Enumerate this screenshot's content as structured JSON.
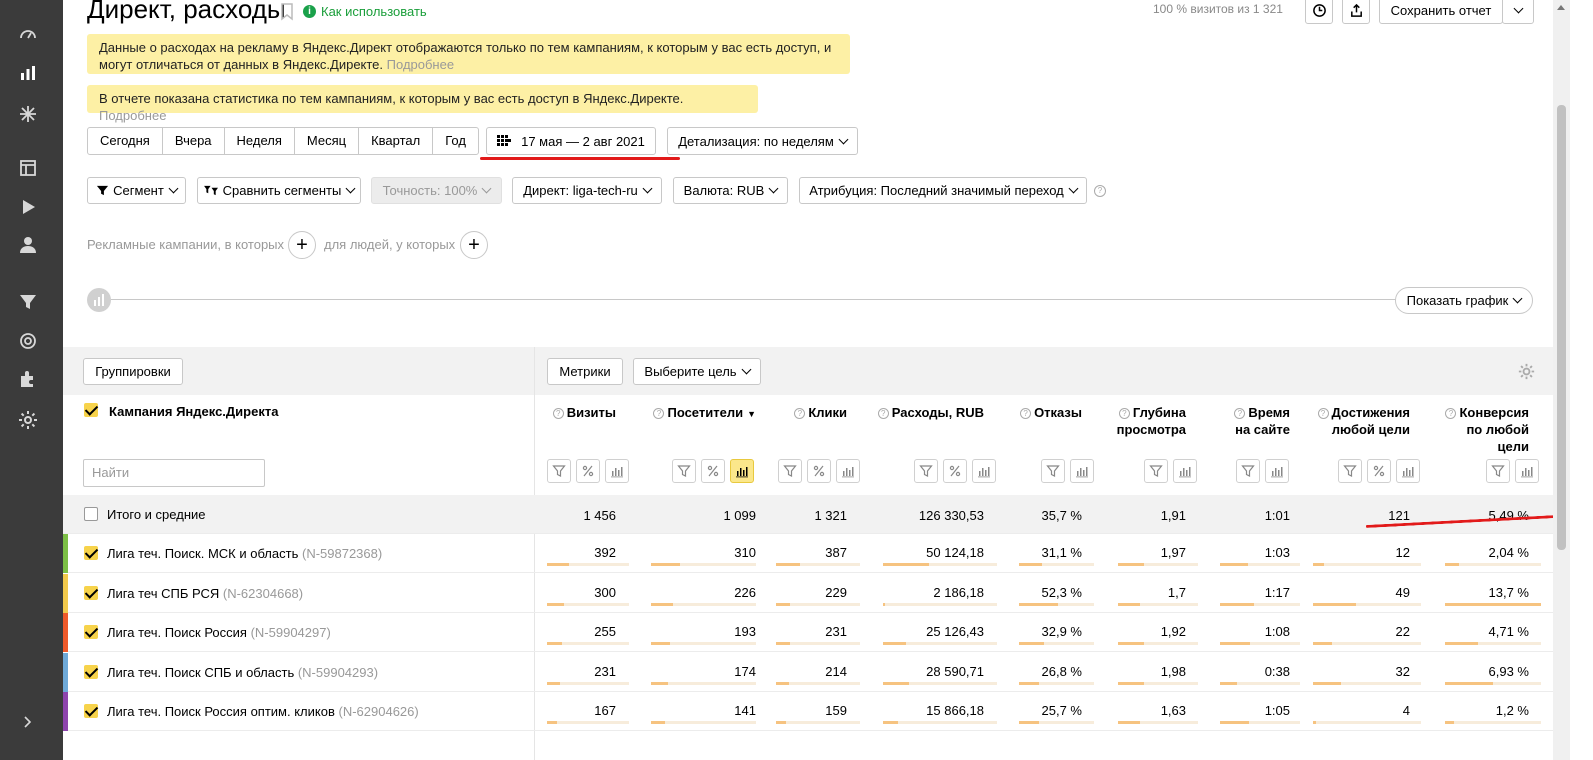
{
  "page": {
    "title": "Директ, расходы",
    "howto": "Как использовать",
    "visits_pct": "100 % визитов из 1 321",
    "save_report": "Сохранить отчет"
  },
  "notices": {
    "n1_text": "Данные о расходах на рекламу в Яндекс.Директ отображаются только по тем кампаниям, к которым у вас есть доступ, и могут отличаться от данных в Яндекс.Директе.",
    "n1_more": "Подробнее",
    "n2_text": "В отчете показана статистика по тем кампаниям, к которым у вас есть доступ в Яндекс.Директе.",
    "n2_more": "Подробнее"
  },
  "periods": [
    "Сегодня",
    "Вчера",
    "Неделя",
    "Месяц",
    "Квартал",
    "Год"
  ],
  "date_range": "17 мая — 2 авг 2021",
  "detail": "Детализация: по неделям",
  "filters": {
    "segment": "Сегмент",
    "compare": "Сравнить сегменты",
    "accuracy": "Точность: 100%",
    "direct": "Директ: liga-tech-ru",
    "currency": "Валюта: RUB",
    "attribution": "Атрибуция: Последний значимый переход"
  },
  "ad_filter": {
    "part1": "Рекламные кампании, в которых",
    "part2": "для людей, у которых"
  },
  "show_chart": "Показать график",
  "table": {
    "groupings": "Группировки",
    "metrics": "Метрики",
    "goal": "Выберите цель",
    "dim_header": "Кампания Яндекс.Директа",
    "search_placeholder": "Найти",
    "columns": {
      "visits": "Визиты",
      "visitors": "Посетители",
      "clicks": "Клики",
      "cost": "Расходы, RUB",
      "bounce": "Отказы",
      "depth_1": "Глубина",
      "depth_2": "просмотра",
      "time_1": "Время",
      "time_2": "на сайте",
      "goals_1": "Достижения",
      "goals_2": "любой цели",
      "conv_1": "Конверсия",
      "conv_2": "по любой",
      "conv_3": "цели"
    },
    "totals": {
      "name": "Итого и средние",
      "visits": "1 456",
      "visitors": "1 099",
      "clicks": "1 321",
      "cost": "126 330,53",
      "bounce": "35,7 %",
      "depth": "1,91",
      "time": "1:01",
      "goals": "121",
      "conv": "5,49 %"
    },
    "rows": [
      {
        "name": "Лига теч. Поиск. МСК и область",
        "id": "(N-59872368)",
        "color": "#7cbf45",
        "visits": "392",
        "visitors": "310",
        "clicks": "387",
        "cost": "50 124,18",
        "bounce": "31,1 %",
        "depth": "1,97",
        "time": "1:03",
        "goals": "12",
        "conv": "2,04 %",
        "bars": {
          "visits": 0.27,
          "visitors": 0.28,
          "clicks": 0.29,
          "cost": 0.4,
          "bounce": 0.31,
          "depth": 0.33,
          "time": 0.35,
          "goals": 0.1,
          "conv": 0.15
        }
      },
      {
        "name": "Лига теч СПБ РСЯ",
        "id": "(N-62304668)",
        "color": "#f2c94c",
        "visits": "300",
        "visitors": "226",
        "clicks": "229",
        "cost": "2 186,18",
        "bounce": "52,3 %",
        "depth": "1,7",
        "time": "1:17",
        "goals": "49",
        "conv": "13,7 %",
        "bars": {
          "visits": 0.21,
          "visitors": 0.21,
          "clicks": 0.17,
          "cost": 0.02,
          "bounce": 0.52,
          "depth": 0.28,
          "time": 0.42,
          "goals": 0.4,
          "conv": 1.0
        }
      },
      {
        "name": "Лига теч. Поиск Россия",
        "id": "(N-59904297)",
        "color": "#ef5a2a",
        "visits": "255",
        "visitors": "193",
        "clicks": "231",
        "cost": "25 126,43",
        "bounce": "32,9 %",
        "depth": "1,92",
        "time": "1:08",
        "goals": "22",
        "conv": "4,71 %",
        "bars": {
          "visits": 0.18,
          "visitors": 0.18,
          "clicks": 0.17,
          "cost": 0.2,
          "bounce": 0.33,
          "depth": 0.32,
          "time": 0.38,
          "goals": 0.18,
          "conv": 0.34
        }
      },
      {
        "name": "Лига теч. Поиск СПБ и область",
        "id": "(N-59904293)",
        "color": "#6ea9d8",
        "visits": "231",
        "visitors": "174",
        "clicks": "214",
        "cost": "28 590,71",
        "bounce": "26,8 %",
        "depth": "1,98",
        "time": "0:38",
        "goals": "32",
        "conv": "6,93 %",
        "bars": {
          "visits": 0.16,
          "visitors": 0.16,
          "clicks": 0.16,
          "cost": 0.23,
          "bounce": 0.27,
          "depth": 0.33,
          "time": 0.21,
          "goals": 0.26,
          "conv": 0.5
        }
      },
      {
        "name": "Лига теч. Поиск Россия оптим. кликов",
        "id": "(N-62904626)",
        "color": "#8e44ad",
        "visits": "167",
        "visitors": "141",
        "clicks": "159",
        "cost": "15 866,18",
        "bounce": "25,7 %",
        "depth": "1,63",
        "time": "1:05",
        "goals": "4",
        "conv": "1,2 %",
        "bars": {
          "visits": 0.12,
          "visitors": 0.13,
          "clicks": 0.12,
          "cost": 0.13,
          "bounce": 0.26,
          "depth": 0.27,
          "time": 0.36,
          "goals": 0.03,
          "conv": 0.09
        }
      }
    ]
  }
}
